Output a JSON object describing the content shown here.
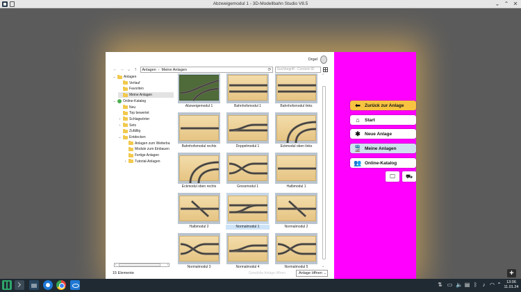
{
  "window": {
    "title": "Abzweigemodul 1 - 3D-Modellbahn Studio V8.5",
    "minimize": "⌄",
    "maximize": "⌃",
    "close": "✕"
  },
  "dialog": {
    "user_name": "Orgel",
    "breadcrumb": [
      "Anlagen",
      "Meine Anlagen"
    ],
    "search_placeholder": "Suchbegriff - Content-ID",
    "tree": [
      {
        "label": "Anlagen",
        "expander": "⌄",
        "icon": "folder"
      },
      {
        "label": "Verlauf",
        "expander": "",
        "icon": "folder"
      },
      {
        "label": "Favoriten",
        "expander": "",
        "icon": "folder"
      },
      {
        "label": "Meine Anlagen",
        "expander": "",
        "icon": "folder",
        "selected": true
      },
      {
        "label": "Online-Katalog",
        "expander": "⌄",
        "icon": "globe"
      },
      {
        "label": "Neu",
        "expander": "",
        "icon": "folder"
      },
      {
        "label": "Top bewertet",
        "expander": "",
        "icon": "folder"
      },
      {
        "label": "Schlagwörter",
        "expander": "›",
        "icon": "folder"
      },
      {
        "label": "Sets",
        "expander": "›",
        "icon": "folder"
      },
      {
        "label": "Zufällig",
        "expander": "",
        "icon": "folder"
      },
      {
        "label": "Entdecken",
        "expander": "⌄",
        "icon": "folder"
      },
      {
        "label": "Anlagen zum Weiterba",
        "expander": "",
        "icon": "folder"
      },
      {
        "label": "Module zum Einbauen",
        "expander": "",
        "icon": "folder"
      },
      {
        "label": "Fertige Anlagen",
        "expander": "",
        "icon": "folder"
      },
      {
        "label": "Tutorial-Anlagen",
        "expander": "›",
        "icon": "folder"
      }
    ],
    "items": [
      {
        "label": "Abzweigemodul 1",
        "thumb": "green-branch"
      },
      {
        "label": "Bahnhofsmodul 1",
        "thumb": "parallel"
      },
      {
        "label": "Bahnhofsmodul links",
        "thumb": "parallel"
      },
      {
        "label": "Bahnhofsmodul rechts",
        "thumb": "straight"
      },
      {
        "label": "Doppelmodul 1",
        "thumb": "double-switch"
      },
      {
        "label": "Eckmodul oben links",
        "thumb": "corner"
      },
      {
        "label": "Eckmodul oben rechts",
        "thumb": "corner"
      },
      {
        "label": "Grossmodul 1",
        "thumb": "wave"
      },
      {
        "label": "Halbmodul 1",
        "thumb": "straight"
      },
      {
        "label": "Halbmodul 2",
        "thumb": "cross"
      },
      {
        "label": "Normalmodul 1",
        "thumb": "parallel-switch",
        "selected": true
      },
      {
        "label": "Normalmodul 2",
        "thumb": "cross"
      },
      {
        "label": "Normalmodul 3",
        "thumb": "wave"
      },
      {
        "label": "Normalmodul 4",
        "thumb": "double-switch"
      },
      {
        "label": "Normalmodul 5",
        "thumb": "wave"
      }
    ],
    "status_count": "15 Elemente",
    "status_hint": "Gewählte Anlage öffnen",
    "open_button": "Anlage öffnen"
  },
  "menu": {
    "buttons": [
      {
        "label": "Zurück zur Anlage",
        "icon": "arrow-left-icon",
        "glyph": "⬅",
        "style": "back"
      },
      {
        "label": "Start",
        "icon": "home-icon",
        "glyph": "⌂",
        "style": "normal"
      },
      {
        "label": "Neue Anlage",
        "icon": "sparkle-icon",
        "glyph": "✱",
        "style": "normal"
      },
      {
        "label": "Meine Anlagen",
        "icon": "train-icon",
        "glyph": "🚆",
        "style": "active"
      },
      {
        "label": "Online-Katalog",
        "icon": "users-icon",
        "glyph": "👥",
        "style": "normal"
      }
    ],
    "small_buttons": [
      {
        "icon": "monitor-icon",
        "glyph": "🖵"
      },
      {
        "icon": "car-icon",
        "glyph": "⛟"
      }
    ]
  },
  "plus_label": "+",
  "taskbar": {
    "time": "13:06",
    "date": "11.01.24"
  }
}
